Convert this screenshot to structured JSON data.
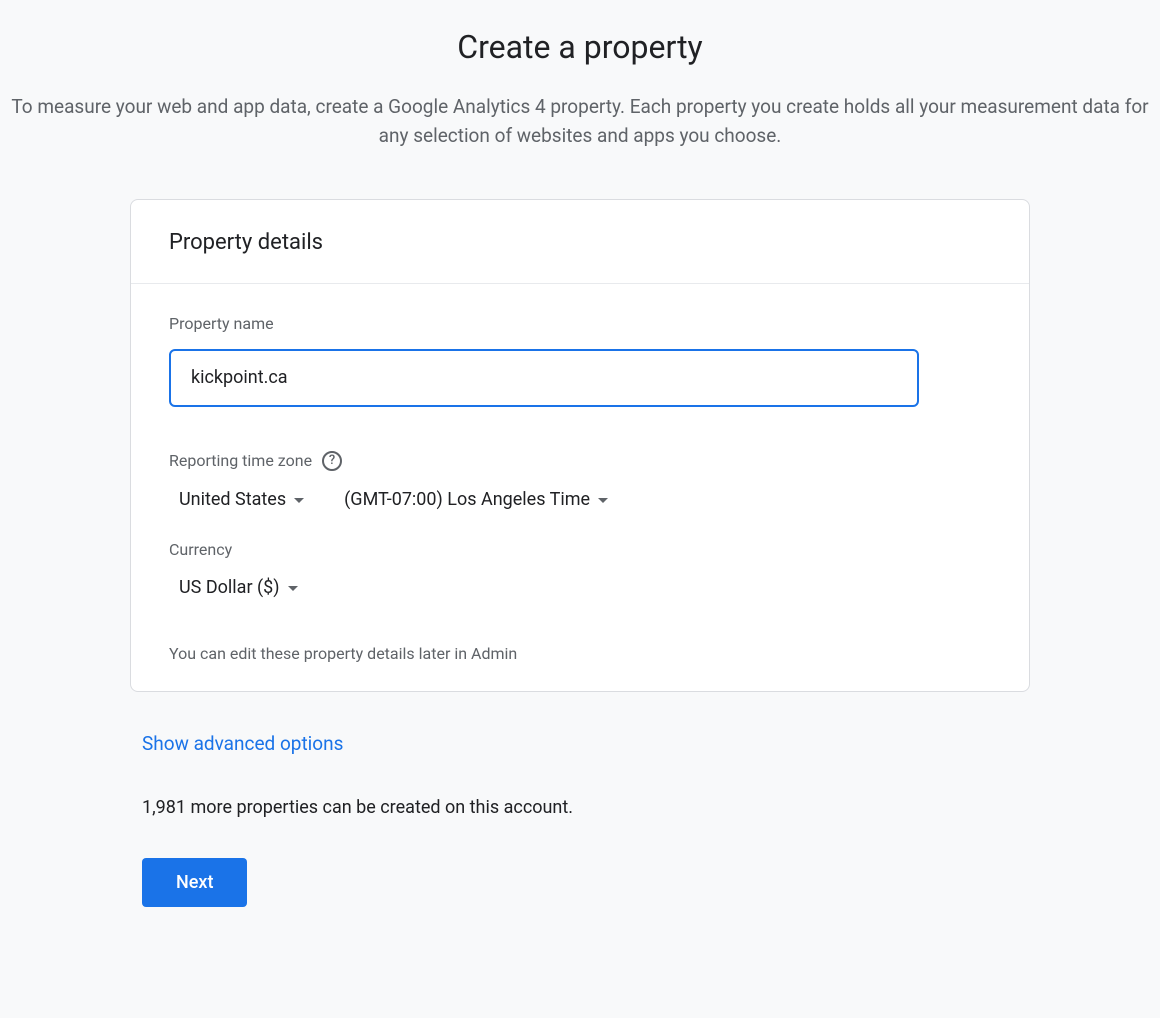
{
  "header": {
    "title": "Create a property",
    "subtitle": "To measure your web and app data, create a Google Analytics 4 property. Each property you create holds all your measurement data for any selection of websites and apps you choose."
  },
  "card": {
    "title": "Property details",
    "propertyName": {
      "label": "Property name",
      "value": "kickpoint.ca"
    },
    "timezone": {
      "label": "Reporting time zone",
      "country": "United States",
      "zone": "(GMT-07:00) Los Angeles Time"
    },
    "currency": {
      "label": "Currency",
      "value": "US Dollar ($)"
    },
    "hint": "You can edit these property details later in Admin"
  },
  "advancedLink": "Show advanced options",
  "quota": "1,981 more properties can be created on this account.",
  "nextButton": "Next"
}
